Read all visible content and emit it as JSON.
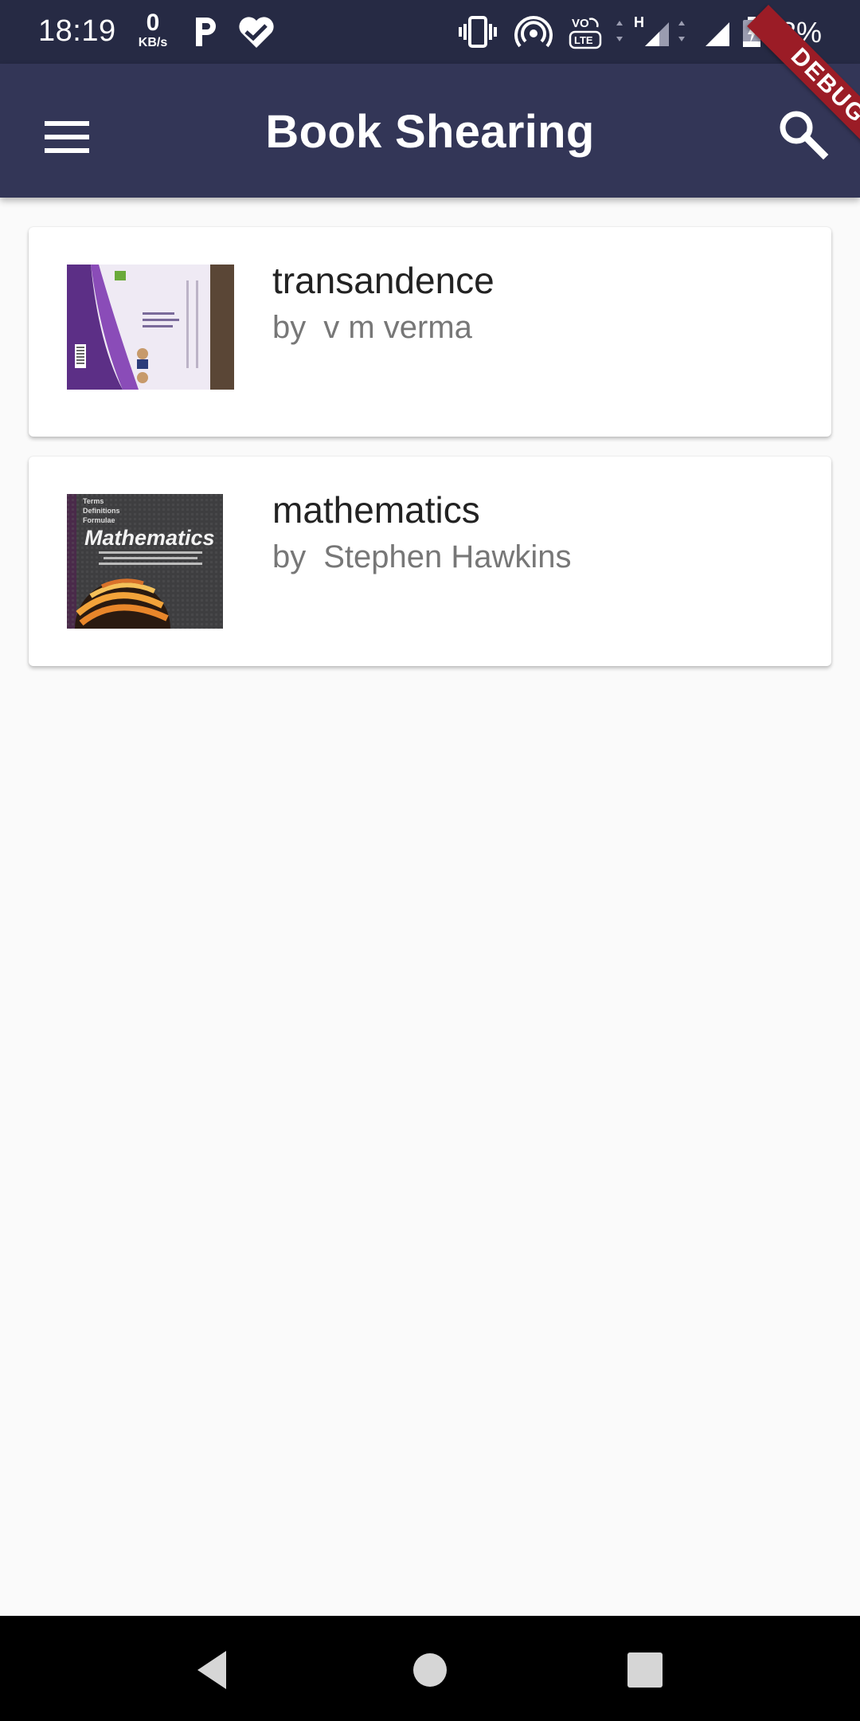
{
  "status_bar": {
    "time": "18:19",
    "net_speed_value": "0",
    "net_speed_unit": "KB/s",
    "battery_percent": "18%",
    "icons": [
      "parking-icon",
      "heart-icon",
      "vibrate-icon",
      "hotspot-icon",
      "volte-icon",
      "signal-icon",
      "signal-icon",
      "battery-charging-icon"
    ]
  },
  "app_bar": {
    "title": "Book Shearing",
    "menu_icon": "menu-icon",
    "search_icon": "search-icon"
  },
  "debug_banner": "DEBUG",
  "books": [
    {
      "title": "transandence",
      "by": "by",
      "author": "v m verma"
    },
    {
      "title": "mathematics",
      "by": "by",
      "author": "Stephen Hawkins"
    }
  ],
  "cover_text": {
    "math_terms": "Terms",
    "math_definitions": "Definitions",
    "math_formulae": "Formulae",
    "math_title": "Mathematics"
  },
  "nav_bar": {
    "icons": [
      "back-icon",
      "home-icon",
      "recents-icon"
    ]
  },
  "colors": {
    "status_bar": "#262a44",
    "app_bar": "#333657",
    "background": "#fafafa",
    "debug_banner": "#9b1c26"
  }
}
